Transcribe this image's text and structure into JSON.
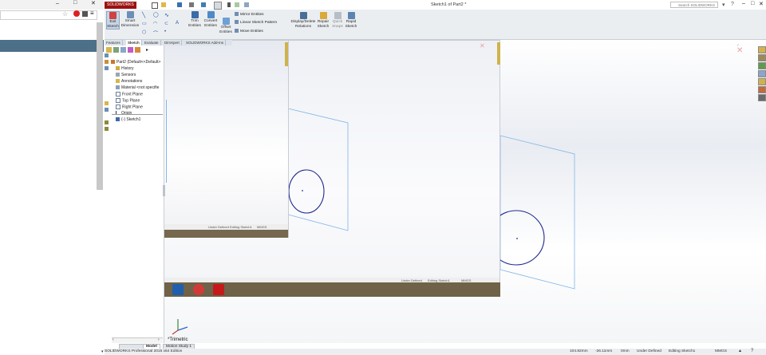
{
  "sw": {
    "logo": "SOLIDWORKS",
    "doc_title": "Sketch1 of Part2 *",
    "search_placeholder": "Search SOLIDWORKS Help"
  },
  "commands": {
    "exit_sketch": "Exit\nSketch",
    "smart_dimension": "Smart\nDimension",
    "trim_entities": "Trim\nEntities",
    "convert_entities": "Convert\nEntities",
    "offset_entities": "Offset\nEntities",
    "mirror_entities": "Mirror Entities",
    "linear_sketch_pattern": "Linear Sketch Pattern",
    "move_entities": "Move Entities",
    "display_delete_relations": "Display/Delete\nRelations",
    "repair_sketch": "Repair\nSketch",
    "quick_snaps": "Quick\nSnaps",
    "rapid_sketch": "Rapid\nSketch"
  },
  "fm_tabs": [
    "Features",
    "Sketch",
    "Evaluate",
    "DimXpert",
    "SOLIDWORKS Add-Ins"
  ],
  "tree": [
    {
      "label": "Part2  (Default<<Default>",
      "icon": "part-icon"
    },
    {
      "label": "History",
      "icon": "history-icon"
    },
    {
      "label": "Sensors",
      "icon": "sensor-icon"
    },
    {
      "label": "Annotations",
      "icon": "annotation-icon"
    },
    {
      "label": "Material <not specifie",
      "icon": "material-icon"
    },
    {
      "label": "Front Plane",
      "icon": "plane-icon"
    },
    {
      "label": "Top Plane",
      "icon": "plane-icon"
    },
    {
      "label": "Right Plane",
      "icon": "plane-icon"
    },
    {
      "label": "Origin",
      "icon": "origin-icon"
    },
    {
      "label": "(-) Sketch1",
      "icon": "sketch-icon"
    }
  ],
  "viewport": {
    "view_label": "*Trimetric",
    "mini_status_small": [
      "Under Defined",
      "Editing Sketch1",
      "MMGS"
    ],
    "mini_status_tiny": [
      "Under Defined",
      "Editing Sketch1",
      "MMGS"
    ]
  },
  "bottom_tabs": [
    "Model",
    "Motion Study 1"
  ],
  "status": {
    "product": "SOLIDWORKS Professional 2015 x64 Edition",
    "x": "104.82mm",
    "y": "-26.11mm",
    "z": "0mm",
    "state": "Under Defined",
    "editing": "Editing Sketch1",
    "units": "MMGS"
  },
  "colors": {
    "accent_red": "#9b1111",
    "sketch_blue": "#1f2a8f",
    "plane_blue": "#7fb6e8"
  }
}
